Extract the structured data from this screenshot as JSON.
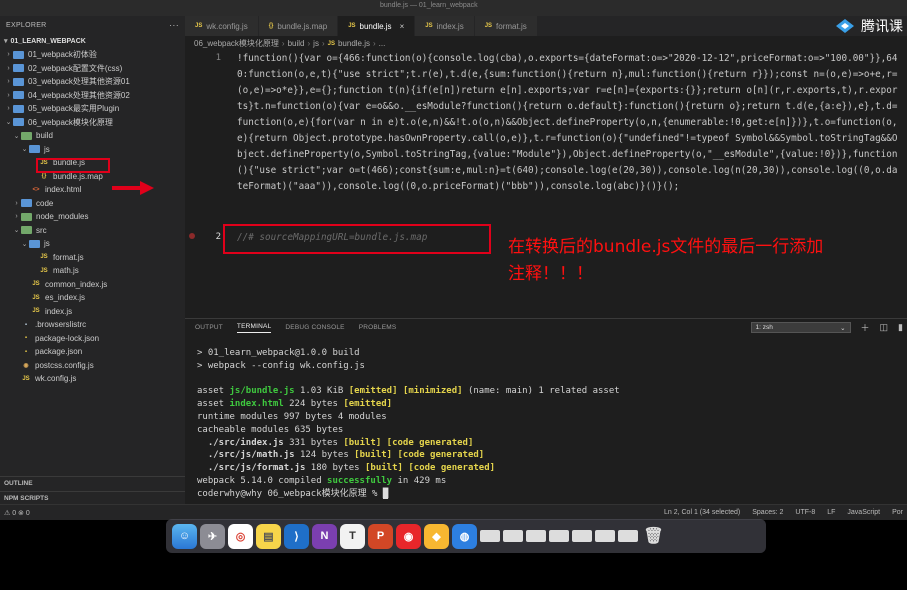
{
  "window_title": "bundle.js — 01_learn_webpack",
  "explorer": {
    "header": "EXPLORER",
    "more": "···",
    "root": "01_LEARN_WEBPACK",
    "items": [
      {
        "label": "01_webpack初体验",
        "kind": "folder"
      },
      {
        "label": "02_webpack配置文件(css)",
        "kind": "folder"
      },
      {
        "label": "03_webpack处理其他资源01",
        "kind": "folder"
      },
      {
        "label": "04_webpack处理其他资源02",
        "kind": "folder"
      },
      {
        "label": "05_webpack最实用Plugin",
        "kind": "folder"
      },
      {
        "label": "06_webpack模块化原理",
        "kind": "folder-open"
      },
      {
        "label": "build",
        "kind": "folder-open"
      },
      {
        "label": "js",
        "kind": "folder-open"
      },
      {
        "label": "bundle.js",
        "kind": "js"
      },
      {
        "label": "bundle.js.map",
        "kind": "map"
      },
      {
        "label": "index.html",
        "kind": "html"
      },
      {
        "label": "code",
        "kind": "folder"
      },
      {
        "label": "node_modules",
        "kind": "folder"
      },
      {
        "label": "src",
        "kind": "folder-open"
      },
      {
        "label": "js",
        "kind": "folder-open"
      },
      {
        "label": "format.js",
        "kind": "js"
      },
      {
        "label": "math.js",
        "kind": "js"
      },
      {
        "label": "common_index.js",
        "kind": "js"
      },
      {
        "label": "es_index.js",
        "kind": "js"
      },
      {
        "label": "index.js",
        "kind": "js"
      },
      {
        "label": ".browserslistrc",
        "kind": "dot"
      },
      {
        "label": "package-lock.json",
        "kind": "json"
      },
      {
        "label": "package.json",
        "kind": "json"
      },
      {
        "label": "postcss.config.js",
        "kind": "css"
      },
      {
        "label": "wk.config.js",
        "kind": "js"
      }
    ],
    "outline": "OUTLINE",
    "npm_scripts": "NPM SCRIPTS"
  },
  "tabs": [
    {
      "label": "wk.config.js",
      "icon": "JS",
      "active": false
    },
    {
      "label": "bundle.js.map",
      "icon": "{}",
      "active": false
    },
    {
      "label": "bundle.js",
      "icon": "JS",
      "active": true
    },
    {
      "label": "index.js",
      "icon": "JS",
      "active": false
    },
    {
      "label": "format.js",
      "icon": "JS",
      "active": false
    }
  ],
  "brand": "腾讯课",
  "breadcrumb": [
    "06_webpack模块化原理",
    "build",
    "js",
    "bundle.js",
    "..."
  ],
  "code": {
    "line1_no": "1",
    "line2_no": "2",
    "line1": "!function(){var o={466:function(o){console.log(cba),o.exports={dateFormat:o=>\"2020-12-12\",priceFormat:o=>\"100.00\"}},640:function(o,e,t){\"use strict\";t.r(e),t.d(e,{sum:function(){return n},mul:function(){return r}});const n=(o,e)=>o+e,r=(o,e)=>o*e}},e={};function t(n){if(e[n])return e[n].exports;var r=e[n]={exports:{}};return o[n](r,r.exports,t),r.exports}t.n=function(o){var e=o&&o.__esModule?function(){return o.default}:function(){return o};return t.d(e,{a:e}),e},t.d=function(o,e){for(var n in e)t.o(e,n)&&!t.o(o,n)&&Object.defineProperty(o,n,{enumerable:!0,get:e[n]})},t.o=function(o,e){return Object.prototype.hasOwnProperty.call(o,e)},t.r=function(o){\"undefined\"!=typeof Symbol&&Symbol.toStringTag&&Object.defineProperty(o,Symbol.toStringTag,{value:\"Module\"}),Object.defineProperty(o,\"__esModule\",{value:!0})},function(){\"use strict\";var o=t(466);const{sum:e,mul:n}=t(640);console.log(e(20,30)),console.log(n(20,30)),console.log((0,o.dateFormat)(\"aaa\")),console.log((0,o.priceFormat)(\"bbb\")),console.log(abc)}()}();",
    "line2": "//# sourceMappingURL=bundle.js.map"
  },
  "annotation": "在转换后的bundle.js文件的最后一行添加注释！！！",
  "panel": {
    "tabs": [
      "OUTPUT",
      "TERMINAL",
      "DEBUG CONSOLE",
      "PROBLEMS"
    ],
    "active_tab": "TERMINAL",
    "shell": "1: zsh",
    "terminal": {
      "l1": "> 01_learn_webpack@1.0.0 build",
      "l2": "> webpack --config wk.config.js",
      "asset1_a": "asset ",
      "asset1_name": "js/bundle.js",
      "asset1_b": " 1.03 KiB ",
      "asset1_tag1": "[emitted]",
      "asset1_tag2": "[minimized]",
      "asset1_c": " (name: main) 1 related asset",
      "asset2_a": "asset ",
      "asset2_name": "index.html",
      "asset2_b": " 224 bytes ",
      "asset2_tag": "[emitted]",
      "runtime": "runtime modules 997 bytes 4 modules",
      "cacheable": "cacheable modules 635 bytes",
      "m1_name": "./src/index.js",
      "m1_size": " 331 bytes ",
      "m2_name": "./src/js/math.js",
      "m2_size": " 124 bytes ",
      "m3_name": "./src/js/format.js",
      "m3_size": " 180 bytes ",
      "built": "[built]",
      "generated": "[code generated]",
      "compiled_a": "webpack 5.14.0 compiled ",
      "compiled_ok": "successfully",
      "compiled_b": " in 429 ms",
      "prompt": "coderwhy@why 06_webpack模块化原理 % "
    }
  },
  "status": {
    "left": "⚠ 0  ⊗ 0",
    "position": "Ln 2, Col 1 (34 selected)",
    "spaces": "Spaces: 2",
    "encoding": "UTF-8",
    "eol": "LF",
    "language": "JavaScript",
    "extra": "Por"
  },
  "dock": {
    "items": [
      "finder",
      "launchpad",
      "chrome",
      "notes",
      "vscode",
      "onenote",
      "typora",
      "powerpoint",
      "netease-music",
      "sketch",
      "qq",
      "preview-windows",
      "trash"
    ]
  }
}
